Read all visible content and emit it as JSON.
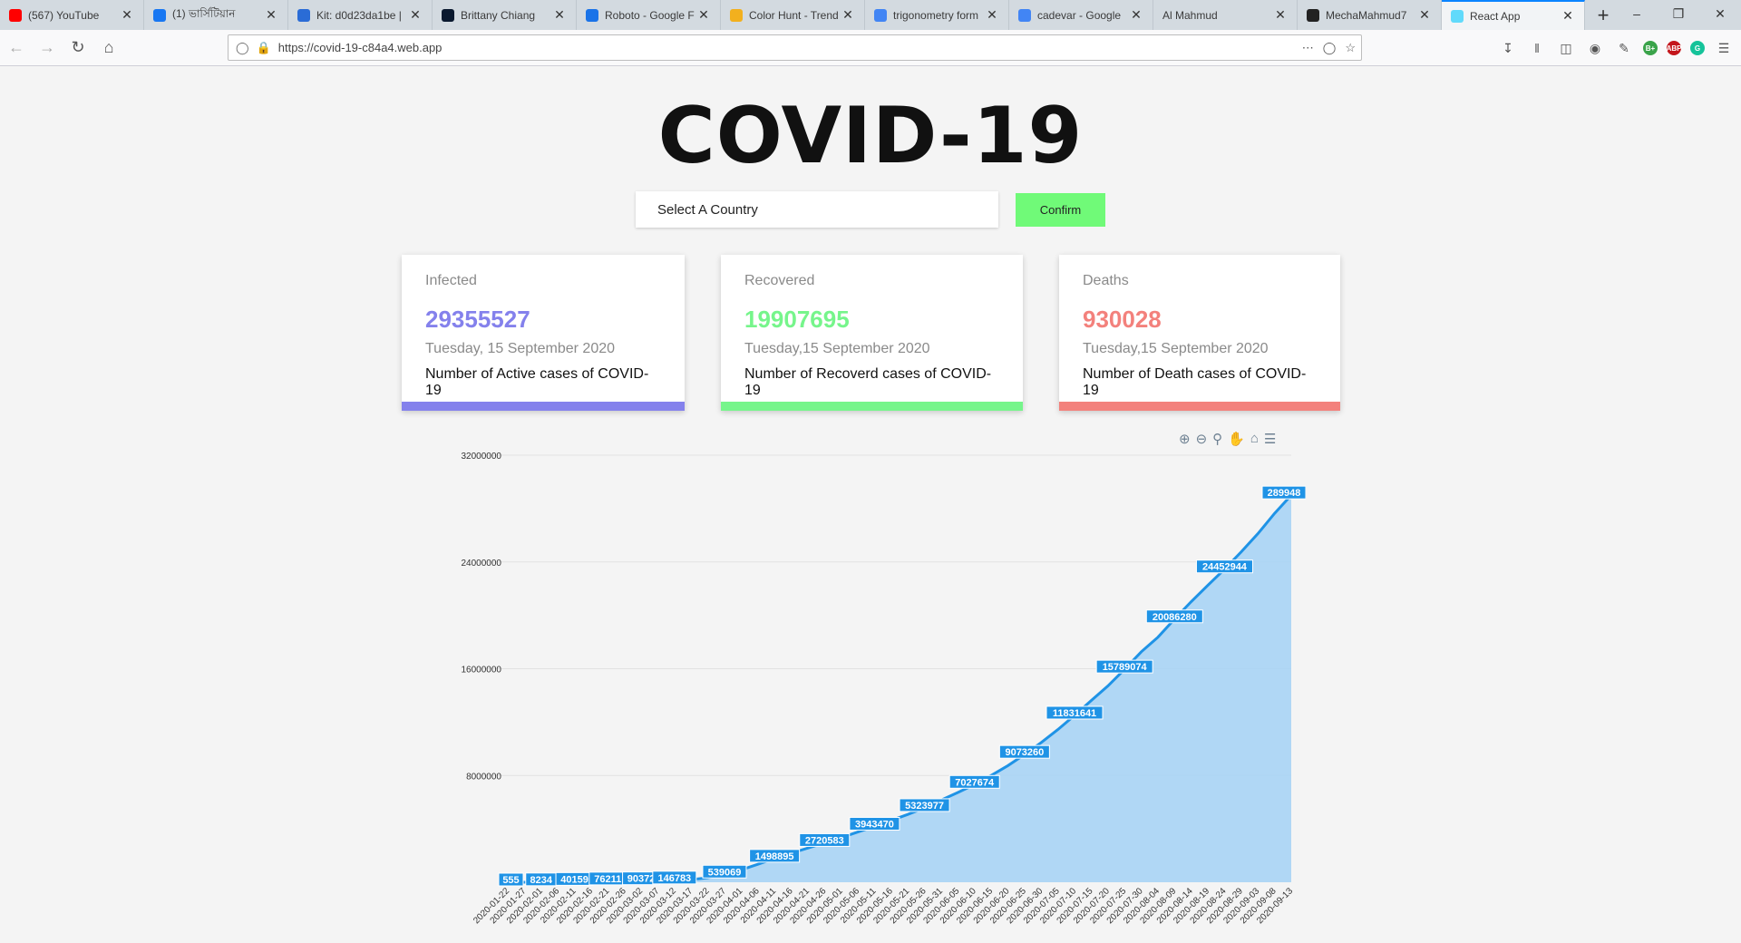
{
  "browser": {
    "tabs": [
      {
        "label": "(567) YouTube",
        "icon": "youtube-icon",
        "color": "#ff0000"
      },
      {
        "label": "(1) ভার্সিটিয়ান",
        "icon": "facebook-icon",
        "color": "#1877f2"
      },
      {
        "label": "Kit: d0d23da1be |",
        "icon": "flag-icon",
        "color": "#2a6cd6"
      },
      {
        "label": "Brittany Chiang",
        "icon": "b-logo-icon",
        "color": "#0a192f"
      },
      {
        "label": "Roboto - Google F",
        "icon": "google-fonts-icon",
        "color": "#1a73e8"
      },
      {
        "label": "Color Hunt - Trend",
        "icon": "color-hunt-icon",
        "color": "#f2b01e"
      },
      {
        "label": "trigonometry form",
        "icon": "google-icon",
        "color": "#4285f4"
      },
      {
        "label": "cadevar - Google",
        "icon": "google-icon",
        "color": "#4285f4"
      },
      {
        "label": "Al Mahmud",
        "icon": "",
        "color": ""
      },
      {
        "label": "MechaMahmud7",
        "icon": "github-icon",
        "color": "#222"
      },
      {
        "label": "React App",
        "icon": "react-icon",
        "color": "#61dafb"
      }
    ],
    "url": "https://covid-19-c84a4.web.app"
  },
  "page": {
    "title": "COVID-19",
    "select_placeholder": "Select A Country",
    "confirm_label": "Confirm"
  },
  "cards": [
    {
      "caption": "Infected",
      "value": "29355527",
      "date": "Tuesday, 15 September 2020",
      "desc": "Number of Active cases of COVID-19",
      "color": "#8481ec"
    },
    {
      "caption": "Recovered",
      "value": "19907695",
      "date": "Tuesday,15 September 2020",
      "desc": "Number of Recoverd cases of COVID-19",
      "color": "#76f58b"
    },
    {
      "caption": "Deaths",
      "value": "930028",
      "date": "Tuesday,15 September 2020",
      "desc": "Number of Death cases of COVID-19",
      "color": "#f3817c"
    }
  ],
  "chart_data": {
    "type": "area",
    "ylim": [
      0,
      32000000
    ],
    "yticks": [
      "32000000",
      "24000000",
      "16000000",
      "8000000"
    ],
    "x": [
      "2020-01-22",
      "2020-01-27",
      "2020-02-01",
      "2020-02-06",
      "2020-02-11",
      "2020-02-16",
      "2020-02-21",
      "2020-02-26",
      "2020-03-02",
      "2020-03-07",
      "2020-03-12",
      "2020-03-17",
      "2020-03-22",
      "2020-03-27",
      "2020-04-01",
      "2020-04-06",
      "2020-04-11",
      "2020-04-16",
      "2020-04-21",
      "2020-04-26",
      "2020-05-01",
      "2020-05-06",
      "2020-05-11",
      "2020-05-16",
      "2020-05-21",
      "2020-05-26",
      "2020-05-31",
      "2020-06-05",
      "2020-06-10",
      "2020-06-15",
      "2020-06-20",
      "2020-06-25",
      "2020-06-30",
      "2020-07-05",
      "2020-07-10",
      "2020-07-15",
      "2020-07-20",
      "2020-07-25",
      "2020-07-30",
      "2020-08-04",
      "2020-08-09",
      "2020-08-14",
      "2020-08-19",
      "2020-08-24",
      "2020-08-29",
      "2020-09-03",
      "2020-09-08",
      "2020-09-13"
    ],
    "labels": [
      "555",
      "8234",
      "40159",
      "76211",
      "90372",
      "146783",
      "539069",
      "1498895",
      "2720583",
      "3943470",
      "5323977",
      "7027674",
      "9073260",
      "11831641",
      "15789074",
      "20086280",
      "24452944",
      "289948"
    ],
    "label_dates": [
      "2020-01-22",
      "2020-02-01",
      "2020-02-11",
      "2020-02-21",
      "2020-03-02",
      "2020-03-12",
      "2020-03-27",
      "2020-04-11",
      "2020-04-26",
      "2020-05-11",
      "2020-05-26",
      "2020-06-10",
      "2020-06-25",
      "2020-07-10",
      "2020-07-25",
      "2020-08-09",
      "2020-08-24",
      "2020-09-13"
    ],
    "values": [
      555,
      2927,
      11950,
      28276,
      43103,
      69032,
      76211,
      80000,
      90372,
      105835,
      146783,
      197171,
      336953,
      593291,
      932605,
      1345101,
      1776867,
      2179139,
      2563053,
      2959929,
      3343777,
      3768000,
      4180000,
      4631000,
      5084000,
      5575000,
      6155000,
      6726000,
      7318000,
      8005000,
      8736000,
      9568000,
      10467000,
      11441000,
      12502000,
      13616000,
      14706000,
      15957000,
      17262000,
      18356000,
      19718000,
      21026000,
      22257000,
      23458000,
      24754000,
      26121000,
      27637000,
      28999486
    ],
    "area_color": "#a9d4f5",
    "line_color": "#1f93e6"
  }
}
